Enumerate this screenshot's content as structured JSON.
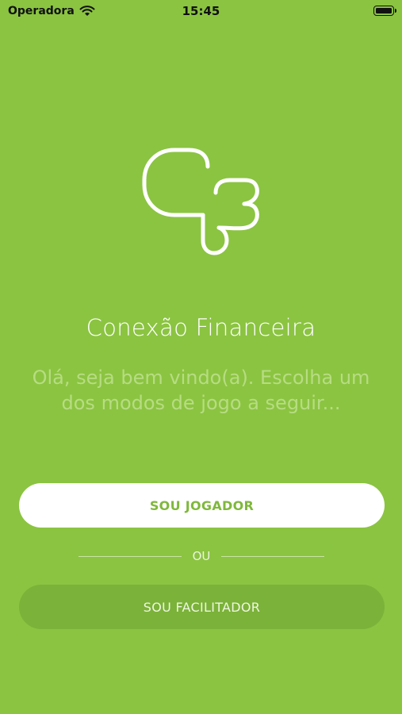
{
  "status_bar": {
    "carrier": "Operadora",
    "time": "15:45"
  },
  "app": {
    "title": "Conexão Financeira",
    "subtitle": "Olá, seja bem vindo(a). Escolha um dos modos de jogo a seguir..."
  },
  "buttons": {
    "player_label": "SOU JOGADOR",
    "facilitator_label": "SOU FACILITADOR"
  },
  "divider": {
    "label": "OU"
  },
  "colors": {
    "background": "#8bc441",
    "primary_button_bg": "#ffffff",
    "primary_button_text": "#7fb83b",
    "secondary_button_bg": "#7bb239"
  }
}
